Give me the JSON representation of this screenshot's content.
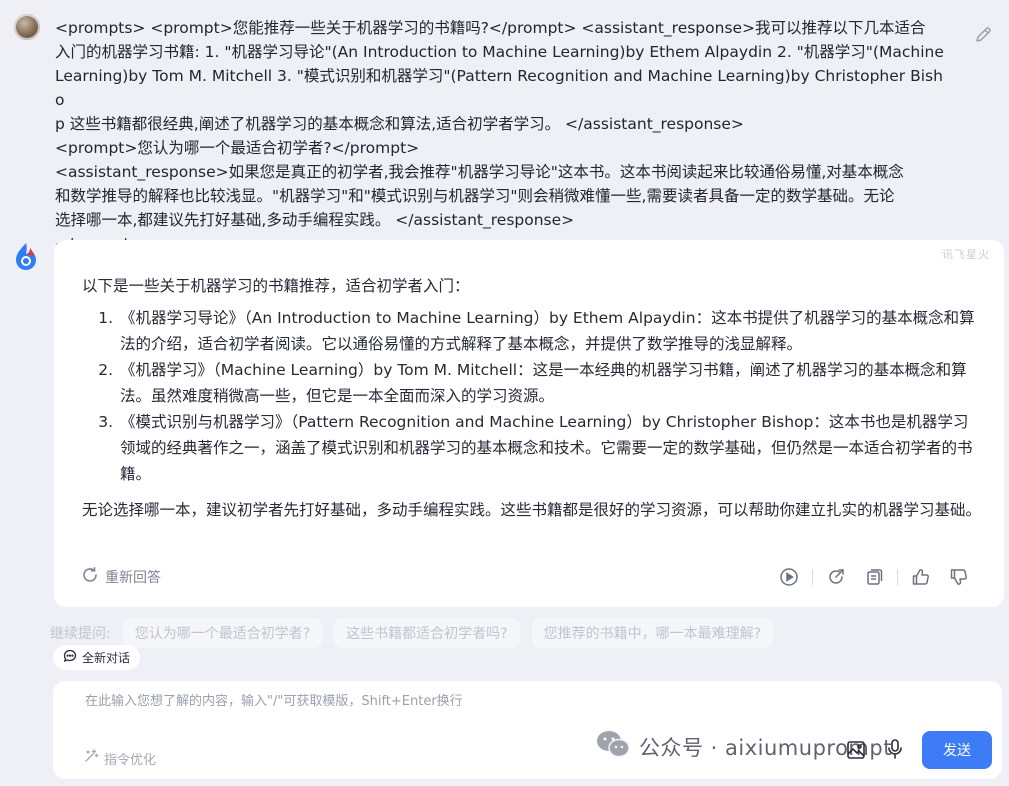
{
  "user_message": {
    "lines": [
      "<prompts> <prompt>您能推荐一些关于机器学习的书籍吗?</prompt> <assistant_response>我可以推荐以下几本适合",
      "入门的机器学习书籍: 1. \"机器学习导论\"(An Introduction to Machine Learning)by Ethem Alpaydin 2. \"机器学习\"(Machine",
      "Learning)by Tom M. Mitchell 3. \"模式识别和机器学习\"(Pattern Recognition and Machine Learning)by Christopher Bisho",
      "p 这些书籍都很经典,阐述了机器学习的基本概念和算法,适合初学者学习。 </assistant_response>",
      "<prompt>您认为哪一个最适合初学者?</prompt>",
      "<assistant_response>如果您是真正的初学者,我会推荐\"机器学习导论\"这本书。这本书阅读起来比较通俗易懂,对基本概念",
      "和数学推导的解释也比较浅显。\"机器学习\"和\"模式识别与机器学习\"则会稍微难懂一些,需要读者具备一定的数学基础。无论",
      "选择哪一本,都建议先打好基础,多动手编程实践。 </assistant_response>",
      "</prompts>"
    ]
  },
  "answer": {
    "watermark": "讯飞星火",
    "intro": "以下是一些关于机器学习的书籍推荐，适合初学者入门：",
    "items": [
      "《机器学习导论》（An Introduction to Machine Learning）by Ethem Alpaydin：这本书提供了机器学习的基本概念和算法的介绍，适合初学者阅读。它以通俗易懂的方式解释了基本概念，并提供了数学推导的浅显解释。",
      "《机器学习》（Machine Learning）by Tom M. Mitchell：这是一本经典的机器学习书籍，阐述了机器学习的基本概念和算法。虽然难度稍微高一些，但它是一本全面而深入的学习资源。",
      "《模式识别与机器学习》（Pattern Recognition and Machine Learning）by Christopher Bishop：这本书也是机器学习领域的经典著作之一，涵盖了模式识别和机器学习的基本概念和技术。它需要一定的数学基础，但仍然是一本适合初学者的书籍。"
    ],
    "closing": "无论选择哪一本，建议初学者先打好基础，多动手编程实践。这些书籍都是很好的学习资源，可以帮助你建立扎实的机器学习基础。",
    "regenerate_label": "重新回答"
  },
  "suggestions": {
    "label": "继续提问:",
    "items": [
      "您认为哪一个最适合初学者?",
      "这些书籍都适合初学者吗?",
      "您推荐的书籍中，哪一本最难理解?"
    ]
  },
  "new_chat_label": "全新对话",
  "input": {
    "placeholder": "在此输入您想了解的内容，输入\"/\"可获取模版，Shift+Enter换行",
    "prompt_optimize_label": "指令优化",
    "send_label": "发送"
  },
  "wechat_watermark": {
    "text": "公众号 · aixiumuprompt"
  },
  "colors": {
    "accent": "#3d7bf7",
    "background": "#eef0f6",
    "card": "#ffffff",
    "muted_text": "#7d8596"
  }
}
